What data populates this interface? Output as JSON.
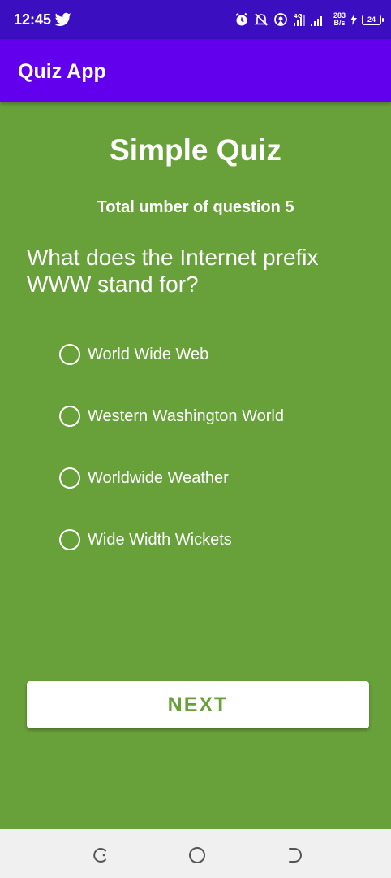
{
  "status_bar": {
    "time": "12:45",
    "net_speed_value": "283",
    "net_speed_unit": "B/s",
    "network_type": "4G",
    "battery_level": "24"
  },
  "app_bar": {
    "title": "Quiz App"
  },
  "quiz": {
    "title": "Simple Quiz",
    "total_label": "Total umber of question 5",
    "question": "What does the Internet prefix WWW stand for?",
    "options": [
      "World Wide Web",
      "Western Washington World",
      "Worldwide Weather",
      "Wide Width Wickets"
    ],
    "next_label": "NEXT"
  },
  "colors": {
    "status_bar": "#3b0fbf",
    "app_bar": "#6200ee",
    "background": "#68a03a",
    "button": "#ffffff",
    "nav_bar": "#f0f0f0"
  },
  "icons": {
    "status": [
      "twitter-icon",
      "alarm-icon",
      "mute-icon",
      "hotspot-icon",
      "signal-icon",
      "battery-icon"
    ],
    "nav": [
      "recents-icon",
      "home-icon",
      "back-icon"
    ]
  }
}
